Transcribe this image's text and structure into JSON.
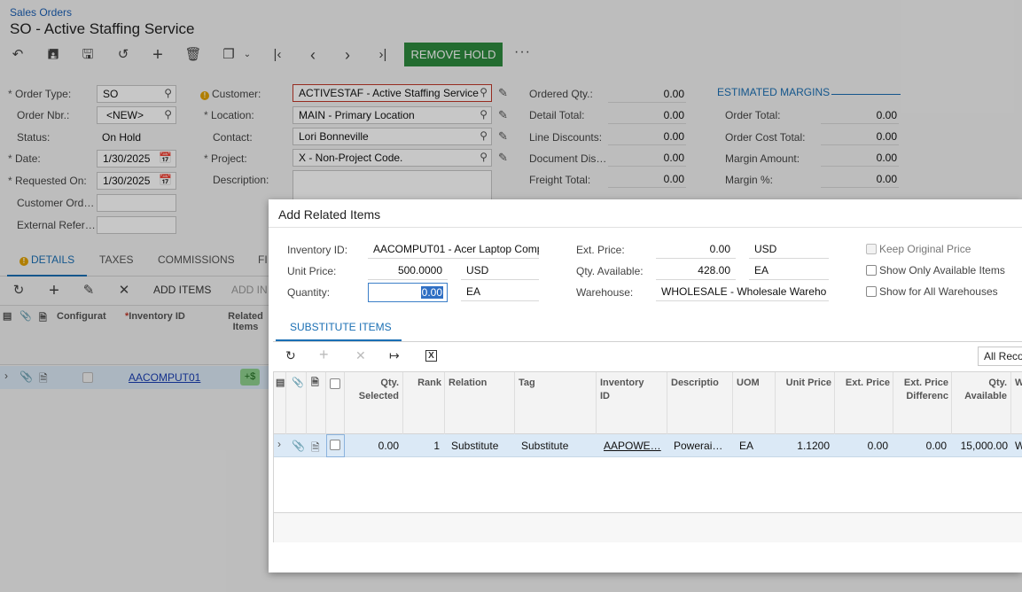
{
  "breadcrumb": "Sales Orders",
  "page_title": "SO - Active Staffing Service",
  "toolbar": {
    "remove_hold": "REMOVE HOLD",
    "more": "···"
  },
  "form": {
    "order_type": {
      "label": "Order Type:",
      "value": "SO"
    },
    "order_nbr": {
      "label": "Order Nbr.:",
      "value": "<NEW>"
    },
    "status": {
      "label": "Status:",
      "value": "On Hold"
    },
    "date": {
      "label": "Date:",
      "value": "1/30/2025"
    },
    "requested_on": {
      "label": "Requested On:",
      "value": "1/30/2025"
    },
    "customer_ord": {
      "label": "Customer Ord…"
    },
    "external_ref": {
      "label": "External Refer…"
    },
    "customer": {
      "label": "Customer:",
      "value": "ACTIVESTAF - Active Staffing Service"
    },
    "location": {
      "label": "Location:",
      "value": "MAIN - Primary Location"
    },
    "contact": {
      "label": "Contact:",
      "value": "Lori Bonneville"
    },
    "project": {
      "label": "Project:",
      "value": "X - Non-Project Code."
    },
    "description": {
      "label": "Description:"
    }
  },
  "totals": [
    {
      "label": "Ordered Qty.:",
      "value": "0.00"
    },
    {
      "label": "Detail Total:",
      "value": "0.00"
    },
    {
      "label": "Line Discounts:",
      "value": "0.00"
    },
    {
      "label": "Document Dis…",
      "value": "0.00"
    },
    {
      "label": "Freight Total:",
      "value": "0.00"
    }
  ],
  "margins": {
    "title": "ESTIMATED MARGINS",
    "rows": [
      {
        "label": "Order Total:",
        "value": "0.00"
      },
      {
        "label": "Order Cost Total:",
        "value": "0.00"
      },
      {
        "label": "Margin Amount:",
        "value": "0.00"
      },
      {
        "label": "Margin %:",
        "value": "0.00"
      }
    ]
  },
  "tabs": [
    "DETAILS",
    "TAXES",
    "COMMISSIONS",
    "FI"
  ],
  "grid_toolbar": {
    "add_items": "ADD ITEMS",
    "add_in": "ADD IN"
  },
  "details_grid": {
    "headers": {
      "config": "Configurat",
      "inventory": "Inventory ID",
      "related": "Related Items"
    },
    "row": {
      "inventory": "AACOMPUT01",
      "related": "+$"
    }
  },
  "dialog": {
    "title": "Add Related Items",
    "inventory_id": {
      "label": "Inventory ID:",
      "value": "AACOMPUT01 - Acer Laptop Comp"
    },
    "unit_price": {
      "label": "Unit Price:",
      "value": "500.0000",
      "currency": "USD"
    },
    "quantity": {
      "label": "Quantity:",
      "value": "0.00",
      "uom": "EA"
    },
    "ext_price": {
      "label": "Ext. Price:",
      "value": "0.00",
      "currency": "USD"
    },
    "qty_available": {
      "label": "Qty. Available:",
      "value": "428.00",
      "uom": "EA"
    },
    "warehouse": {
      "label": "Warehouse:",
      "value": "WHOLESALE - Wholesale Wareho"
    },
    "keep_original_price": "Keep Original Price",
    "show_only_available": "Show Only Available Items",
    "show_all_warehouses": "Show for All Warehouses",
    "substitute_tab": "SUBSTITUTE ITEMS",
    "all_records": "All Reco",
    "columns": {
      "qty_selected": "Qty. Selected",
      "rank": "Rank",
      "relation": "Relation",
      "tag": "Tag",
      "inventory_id": "Inventory ID",
      "description": "Descriptio",
      "uom": "UOM",
      "unit_price": "Unit Price",
      "ext_price": "Ext. Price",
      "ext_price_diff": "Ext. Price Differenc",
      "qty_available": "Qty. Available",
      "w": "W"
    },
    "row": {
      "qty_selected": "0.00",
      "rank": "1",
      "relation": "Substitute",
      "tag": "Substitute",
      "inventory_id": "AAPOWE…",
      "description": "Powerai…",
      "uom": "EA",
      "unit_price": "1.1200",
      "ext_price": "0.00",
      "ext_price_diff": "0.00",
      "qty_available": "15,000.00",
      "w": "W"
    }
  }
}
